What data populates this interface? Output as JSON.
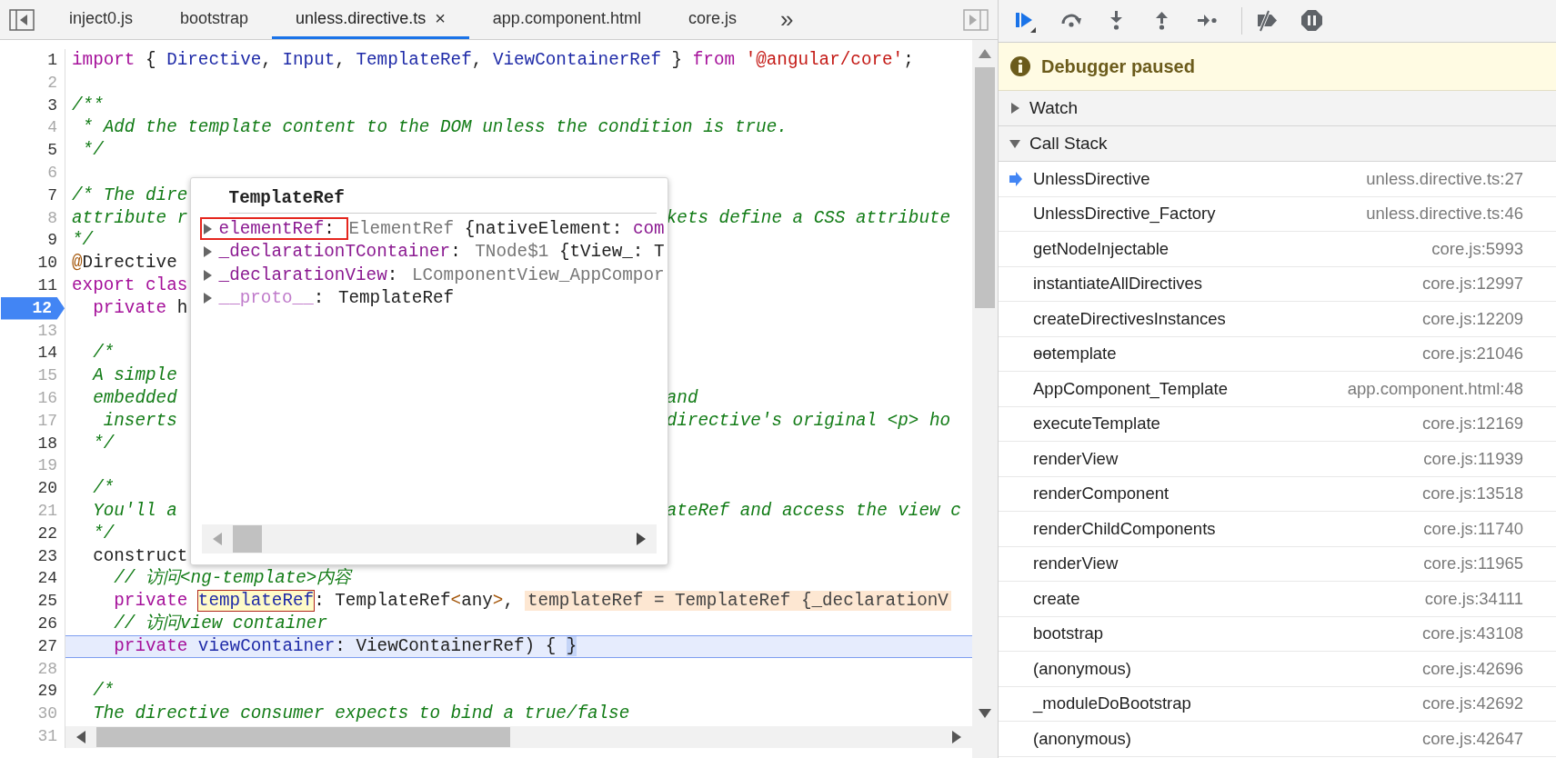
{
  "editor": {
    "tabs": [
      {
        "label": "inject0.js",
        "selected": false
      },
      {
        "label": "bootstrap",
        "selected": false
      },
      {
        "label": "unless.directive.ts",
        "selected": true,
        "close": "×"
      },
      {
        "label": "app.component.html",
        "selected": false
      },
      {
        "label": "core.js",
        "selected": false
      }
    ],
    "tab_overflow": "»",
    "lines": [
      {
        "number": "1",
        "dim": false,
        "breakpoint": false,
        "current": false,
        "tokens": [
          {
            "kind": "kw",
            "t": "import"
          },
          {
            "kind": "pl",
            "t": " { "
          },
          {
            "kind": "id",
            "t": "Directive"
          },
          {
            "kind": "pl",
            "t": ", "
          },
          {
            "kind": "id",
            "t": "Input"
          },
          {
            "kind": "pl",
            "t": ", "
          },
          {
            "kind": "id",
            "t": "TemplateRef"
          },
          {
            "kind": "pl",
            "t": ", "
          },
          {
            "kind": "id",
            "t": "ViewContainerRef"
          },
          {
            "kind": "pl",
            "t": " } "
          },
          {
            "kind": "kw",
            "t": "from "
          },
          {
            "kind": "str",
            "t": "'@angular/core'"
          },
          {
            "kind": "pl",
            "t": ";"
          }
        ]
      },
      {
        "number": "2",
        "dim": true,
        "breakpoint": false,
        "current": false
      },
      {
        "number": "3",
        "dim": false,
        "breakpoint": false,
        "current": false,
        "tokens": [
          {
            "kind": "cm",
            "t": "/**"
          }
        ]
      },
      {
        "number": "4",
        "dim": true,
        "breakpoint": false,
        "current": false,
        "tokens": [
          {
            "kind": "cm",
            "t": " * Add the template content to the DOM unless the condition is true."
          }
        ]
      },
      {
        "number": "5",
        "dim": false,
        "breakpoint": false,
        "current": false,
        "tokens": [
          {
            "kind": "cm",
            "t": " */"
          }
        ]
      },
      {
        "number": "6",
        "dim": true,
        "breakpoint": false,
        "current": false
      },
      {
        "number": "7",
        "dim": false,
        "breakpoint": false,
        "current": false,
        "tokens": [
          {
            "kind": "cm",
            "t": "/* The dire"
          }
        ]
      },
      {
        "number": "8",
        "dim": true,
        "breakpoint": false,
        "current": false,
        "tokens": [
          {
            "kind": "cm",
            "t": "attribute r"
          }
        ],
        "right": [
          {
            "kind": "cm",
            "t": "kets define a CSS attribute"
          }
        ]
      },
      {
        "number": "9",
        "dim": false,
        "breakpoint": false,
        "current": false,
        "tokens": [
          {
            "kind": "cm",
            "t": "*/"
          }
        ]
      },
      {
        "number": "10",
        "dim": false,
        "breakpoint": false,
        "current": false,
        "tokens": [
          {
            "kind": "deco",
            "t": "@"
          },
          {
            "kind": "pl",
            "t": "Directive"
          }
        ]
      },
      {
        "number": "11",
        "dim": false,
        "breakpoint": false,
        "current": false,
        "tokens": [
          {
            "kind": "kw",
            "t": "export clas"
          }
        ]
      },
      {
        "number": "12",
        "dim": false,
        "breakpoint": true,
        "current": false,
        "tokens": [
          {
            "kind": "kw",
            "t": "  private"
          },
          {
            "kind": "pl",
            "t": " h"
          }
        ]
      },
      {
        "number": "13",
        "dim": true,
        "breakpoint": false,
        "current": false
      },
      {
        "number": "14",
        "dim": false,
        "breakpoint": false,
        "current": false,
        "tokens": [
          {
            "kind": "cm",
            "t": "  /*"
          }
        ]
      },
      {
        "number": "15",
        "dim": true,
        "breakpoint": false,
        "current": false,
        "tokens": [
          {
            "kind": "cm",
            "t": "  A simple"
          }
        ]
      },
      {
        "number": "16",
        "dim": true,
        "breakpoint": false,
        "current": false,
        "tokens": [
          {
            "kind": "cm",
            "t": "  embedded"
          }
        ],
        "right": [
          {
            "kind": "cm",
            "t": "and"
          }
        ]
      },
      {
        "number": "17",
        "dim": true,
        "breakpoint": false,
        "current": false,
        "tokens": [
          {
            "kind": "cm",
            "t": "   inserts"
          }
        ],
        "right": [
          {
            "kind": "cm",
            "t": "directive's original <p> ho"
          }
        ]
      },
      {
        "number": "18",
        "dim": false,
        "breakpoint": false,
        "current": false,
        "tokens": [
          {
            "kind": "cm",
            "t": "  */"
          }
        ]
      },
      {
        "number": "19",
        "dim": true,
        "breakpoint": false,
        "current": false
      },
      {
        "number": "20",
        "dim": false,
        "breakpoint": false,
        "current": false,
        "tokens": [
          {
            "kind": "cm",
            "t": "  /*"
          }
        ]
      },
      {
        "number": "21",
        "dim": true,
        "breakpoint": false,
        "current": false,
        "tokens": [
          {
            "kind": "cm",
            "t": "  You'll a"
          }
        ],
        "right": [
          {
            "kind": "cm",
            "t": "ateRef and access the view c"
          }
        ]
      },
      {
        "number": "22",
        "dim": false,
        "breakpoint": false,
        "current": false,
        "tokens": [
          {
            "kind": "cm",
            "t": "  */"
          }
        ]
      },
      {
        "number": "23",
        "dim": false,
        "breakpoint": false,
        "current": false,
        "tokens": [
          {
            "kind": "pl",
            "t": "  construct"
          }
        ]
      },
      {
        "number": "24",
        "dim": false,
        "breakpoint": false,
        "current": false,
        "tokens": [
          {
            "kind": "cm",
            "t": "    // 访问<ng-template>内容"
          }
        ]
      },
      {
        "number": "25",
        "dim": false,
        "breakpoint": false,
        "current": false,
        "tokens": [
          {
            "kind": "kw",
            "t": "    private "
          },
          {
            "kind": "hover",
            "t": "templateRef"
          },
          {
            "kind": "pl",
            "t": ": TemplateRef"
          },
          {
            "kind": "punct",
            "t": "<"
          },
          {
            "kind": "pl",
            "t": "any"
          },
          {
            "kind": "punct",
            "t": ">"
          },
          {
            "kind": "pl",
            "t": ","
          }
        ],
        "inline_value": "templateRef = TemplateRef {_declarationV"
      },
      {
        "number": "26",
        "dim": false,
        "breakpoint": false,
        "current": false,
        "tokens": [
          {
            "kind": "cm",
            "t": "    // 访问view container"
          }
        ]
      },
      {
        "number": "27",
        "dim": false,
        "breakpoint": false,
        "current": true,
        "tokens": [
          {
            "kind": "kw",
            "t": "    private "
          },
          {
            "kind": "id",
            "t": "viewContainer"
          },
          {
            "kind": "pl",
            "t": ": ViewContainerRef) { "
          },
          {
            "kind": "match",
            "t": "}"
          }
        ]
      },
      {
        "number": "28",
        "dim": true,
        "breakpoint": false,
        "current": false
      },
      {
        "number": "29",
        "dim": false,
        "breakpoint": false,
        "current": false,
        "tokens": [
          {
            "kind": "cm",
            "t": "  /*"
          }
        ]
      },
      {
        "number": "30",
        "dim": true,
        "breakpoint": false,
        "current": false,
        "tokens": [
          {
            "kind": "cm",
            "t": "  The directive consumer expects to bind a true/false"
          }
        ]
      },
      {
        "number": "31",
        "dim": true,
        "breakpoint": false,
        "current": false
      }
    ],
    "popover": {
      "title": "TemplateRef",
      "properties": [
        {
          "kind": "own",
          "name": "elementRef",
          "separator": ": ",
          "outlined": true,
          "value": [
            {
              "kind": "type",
              "t": "ElementRef "
            },
            {
              "kind": "pl",
              "t": "{nativeElement: "
            },
            {
              "kind": "prop",
              "t": "com"
            }
          ]
        },
        {
          "kind": "own",
          "name": "_declarationTContainer",
          "separator": ": ",
          "outlined": false,
          "value": [
            {
              "kind": "type",
              "t": "TNode$1 "
            },
            {
              "kind": "pl",
              "t": "{tView_: T"
            }
          ]
        },
        {
          "kind": "own",
          "name": "_declarationView",
          "separator": ": ",
          "outlined": false,
          "value": [
            {
              "kind": "type",
              "t": "LComponentView_AppCompor"
            }
          ]
        },
        {
          "kind": "proto",
          "name": "__proto__",
          "separator": ": ",
          "outlined": false,
          "value": [
            {
              "kind": "pl",
              "t": "TemplateRef"
            }
          ]
        }
      ]
    }
  },
  "debugger": {
    "toolbar": [
      {
        "buttons": [
          {
            "kind": "resume"
          },
          {
            "kind": "step-over"
          },
          {
            "kind": "step-into"
          },
          {
            "kind": "step-out"
          },
          {
            "kind": "step"
          }
        ]
      },
      {
        "buttons": [
          {
            "kind": "deactivate-breakpoints"
          },
          {
            "kind": "pause-on-exceptions"
          }
        ]
      }
    ],
    "banner": "Debugger paused",
    "sections": [
      {
        "label": "Watch",
        "expanded": false
      },
      {
        "label": "Call Stack",
        "expanded": true,
        "frames": [
          {
            "name": "UnlessDirective",
            "location": "unless.directive.ts:27",
            "selected": true
          },
          {
            "name": "UnlessDirective_Factory",
            "location": "unless.directive.ts:46",
            "selected": false
          },
          {
            "name": "getNodeInjectable",
            "location": "core.js:5993",
            "selected": false
          },
          {
            "name": "instantiateAllDirectives",
            "location": "core.js:12997",
            "selected": false
          },
          {
            "name": "createDirectivesInstances",
            "location": "core.js:12209",
            "selected": false
          },
          {
            "name": "ɵɵtemplate",
            "location": "core.js:21046",
            "selected": false
          },
          {
            "name": "AppComponent_Template",
            "location": "app.component.html:48",
            "selected": false
          },
          {
            "name": "executeTemplate",
            "location": "core.js:12169",
            "selected": false
          },
          {
            "name": "renderView",
            "location": "core.js:11939",
            "selected": false
          },
          {
            "name": "renderComponent",
            "location": "core.js:13518",
            "selected": false
          },
          {
            "name": "renderChildComponents",
            "location": "core.js:11740",
            "selected": false
          },
          {
            "name": "renderView",
            "location": "core.js:11965",
            "selected": false
          },
          {
            "name": "create",
            "location": "core.js:34111",
            "selected": false
          },
          {
            "name": "bootstrap",
            "location": "core.js:43108",
            "selected": false
          },
          {
            "name": "(anonymous)",
            "location": "core.js:42696",
            "selected": false
          },
          {
            "name": "_moduleDoBootstrap",
            "location": "core.js:42692",
            "selected": false
          },
          {
            "name": "(anonymous)",
            "location": "core.js:42647",
            "selected": false
          }
        ]
      }
    ]
  }
}
